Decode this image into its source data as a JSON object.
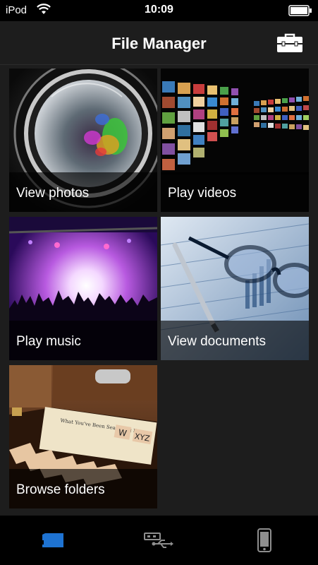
{
  "status_bar": {
    "carrier": "iPod",
    "time": "10:09"
  },
  "nav": {
    "title": "File Manager",
    "toolbox_icon": "toolbox-icon"
  },
  "tiles": [
    {
      "label": "View photos",
      "icon": "camera-lens-image"
    },
    {
      "label": "Play videos",
      "icon": "video-wall-image"
    },
    {
      "label": "Play music",
      "icon": "concert-image"
    },
    {
      "label": "View documents",
      "icon": "documents-glasses-image"
    },
    {
      "label": "Browse folders",
      "icon": "file-drawer-image"
    }
  ],
  "tab_bar": {
    "tabs": [
      {
        "icon": "sd-card-icon",
        "selected": true
      },
      {
        "icon": "usb-icon",
        "selected": false
      },
      {
        "icon": "phone-icon",
        "selected": false
      }
    ],
    "accent": "#1e73d2",
    "inactive_color": "#8e8e8e"
  }
}
